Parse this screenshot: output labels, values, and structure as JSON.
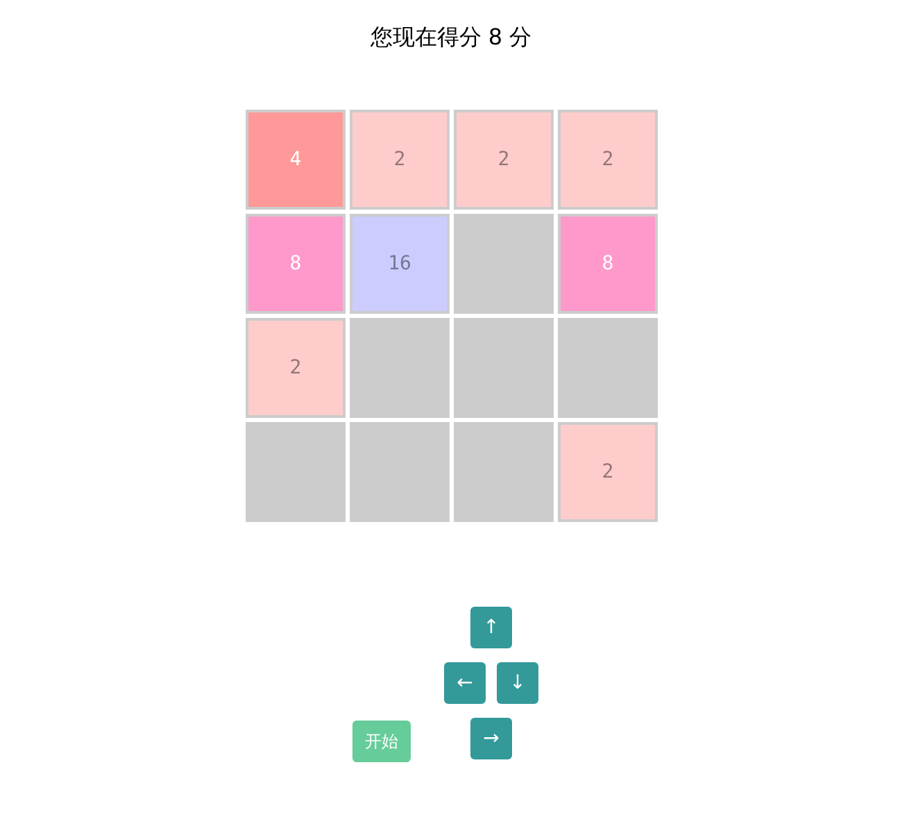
{
  "score_text": "您现在得分 8 分",
  "board": {
    "rows": [
      {
        "cells": [
          {
            "kind": "tile",
            "value": "4",
            "color": "#ff9999"
          },
          {
            "kind": "tile",
            "value": "2",
            "color": "#ffcccc"
          },
          {
            "kind": "tile",
            "value": "2",
            "color": "#ffcccc"
          },
          {
            "kind": "tile",
            "value": "2",
            "color": "#ffcccc"
          }
        ]
      },
      {
        "cells": [
          {
            "kind": "tile",
            "value": "8",
            "color": "#ff99cc"
          },
          {
            "kind": "tile",
            "value": "16",
            "color": "#ccccff"
          },
          {
            "kind": "empty"
          },
          {
            "kind": "tile",
            "value": "8",
            "color": "#ff99cc"
          }
        ]
      },
      {
        "cells": [
          {
            "kind": "tile",
            "value": "2",
            "color": "#ffcccc"
          },
          {
            "kind": "empty"
          },
          {
            "kind": "empty"
          },
          {
            "kind": "empty"
          }
        ]
      },
      {
        "cells": [
          {
            "kind": "empty"
          },
          {
            "kind": "empty"
          },
          {
            "kind": "empty"
          },
          {
            "kind": "tile",
            "value": "2",
            "color": "#ffcccc"
          }
        ]
      }
    ]
  },
  "controls": {
    "start_button": {
      "label": "开始"
    },
    "arrow_buttons": [
      {
        "label": "↑"
      },
      {
        "label": "←"
      },
      {
        "label": "↓"
      },
      {
        "label": "→"
      }
    ]
  }
}
